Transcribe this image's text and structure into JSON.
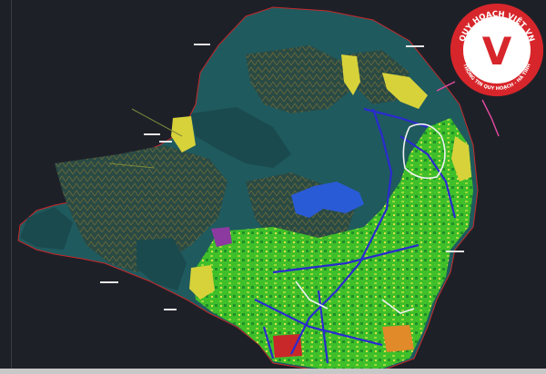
{
  "viewer": {
    "background": "#1e2028",
    "status_bar_color": "#c8c8c8"
  },
  "watermark": {
    "logo_letter": "V",
    "ring_text_top": "QUY HOẠCH VIỆT VN",
    "ring_text_bottom": "THÔNG TIN QUY HOẠCH - HÀ TĨNH",
    "ring_color": "#d7262b",
    "inner_color": "#ffffff"
  },
  "map_colors": {
    "water_teal": "#1f5a5e",
    "forest_hatch": "#3b4a2e",
    "urban_green": "#3fbf2a",
    "agri_yellow": "#d8d23a",
    "lake_blue": "#2a5bd6",
    "road_blue": "#2a2ad0",
    "road_white": "#f2f2f2",
    "boundary_red": "#c8282a",
    "pink_zone": "#e64aa0",
    "purple_zone": "#8c3aa0",
    "orange_zone": "#e08a2a"
  },
  "map_labels": {
    "icon": "map-plan-icon"
  }
}
